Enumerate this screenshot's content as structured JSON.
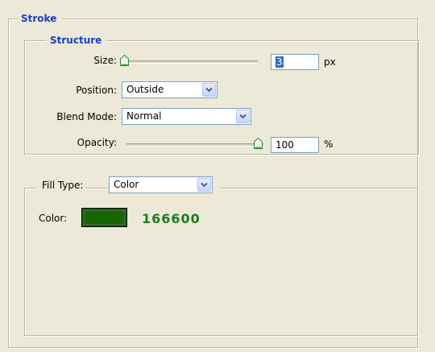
{
  "stroke": {
    "title": "Stroke",
    "structure": {
      "title": "Structure",
      "size": {
        "label": "Size:",
        "value": "3",
        "unit": "px",
        "slider_level": 0.0
      },
      "position": {
        "label": "Position:",
        "selected": "Outside"
      },
      "blend_mode": {
        "label": "Blend Mode:",
        "selected": "Normal"
      },
      "opacity": {
        "label": "Opacity:",
        "value": "100",
        "unit": "%",
        "slider_level": 1.0
      }
    },
    "fill": {
      "fill_type_label": "Fill Type:",
      "fill_type_selected": "Color",
      "color_label": "Color:",
      "color_hex_text": "166600",
      "color_hex": "#166600"
    }
  },
  "colors": {
    "title_blue": "#1a40c9",
    "hex_text_green": "#1f7a1f"
  },
  "icons": {
    "slider_thumb": "slider-thumb-icon",
    "dropdown_arrow": "chevron-down-icon"
  }
}
